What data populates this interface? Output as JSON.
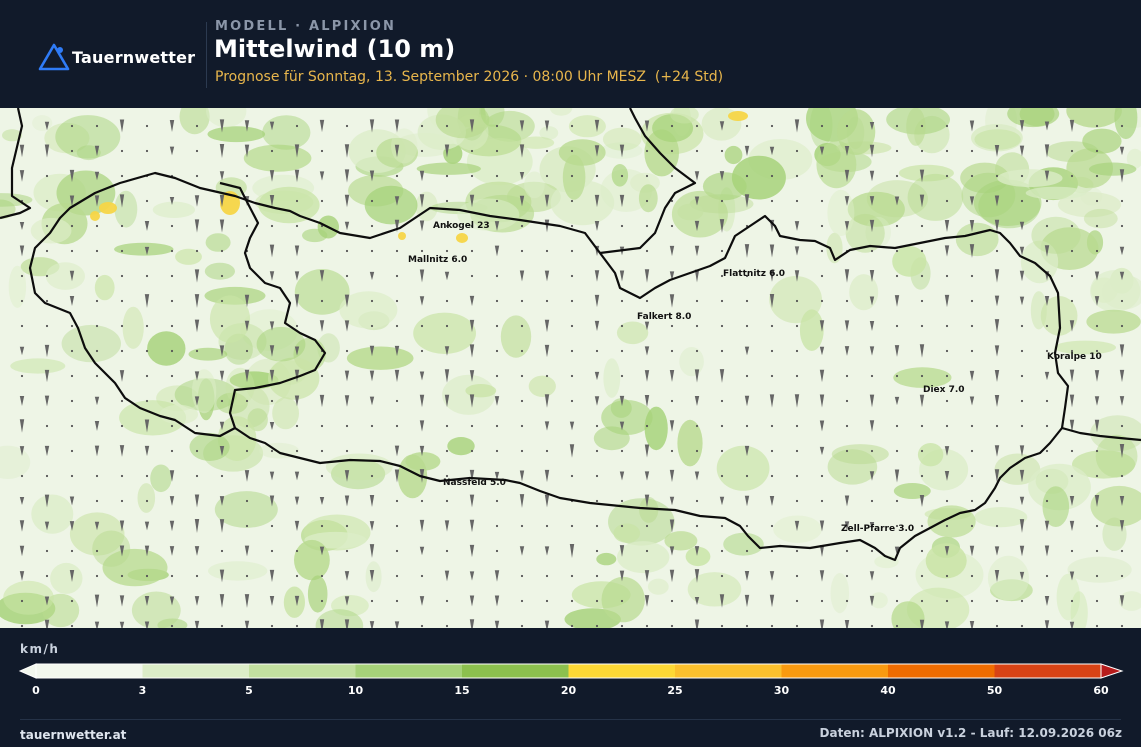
{
  "brand": {
    "name": "Tauernwetter"
  },
  "header": {
    "kicker": "MODELL · ALPIXION",
    "title": "Mittelwind (10 m)",
    "subtitle": "Prognose für Sonntag, 13. September 2026 · 08:00 Uhr MESZ  (+24 Std)"
  },
  "stations": [
    {
      "label": "Ankogel 23"
    },
    {
      "label": "Mallnitz 6.0"
    },
    {
      "label": "Flattnitz 6.0"
    },
    {
      "label": "Falkert 8.0"
    },
    {
      "label": "Koralpe 10"
    },
    {
      "label": "Diex 7.0"
    },
    {
      "label": "Nassfeld 5.0"
    },
    {
      "label": "Zell-Pfarre 3.0"
    }
  ],
  "legend": {
    "unit": "km/h",
    "ticks": [
      "0",
      "3",
      "5",
      "10",
      "15",
      "20",
      "25",
      "30",
      "40",
      "50",
      "60"
    ],
    "colors": [
      "#f3f8ee",
      "#dcedc8",
      "#c3e0a0",
      "#a6d279",
      "#8cc04e",
      "#fdd835",
      "#fbc02d",
      "#f99a10",
      "#ef6c00",
      "#d84315",
      "#b71c1c"
    ]
  },
  "footer": {
    "site": "tauernwetter.at",
    "source": "Daten: ALPIXION v1.2 - Lauf: 12.09.2026 06z"
  },
  "colors": {
    "background": "#111a2a",
    "accent": "#e8b64c",
    "logo_blue": "#2f7bf6",
    "map_base": "#eef5e6"
  }
}
